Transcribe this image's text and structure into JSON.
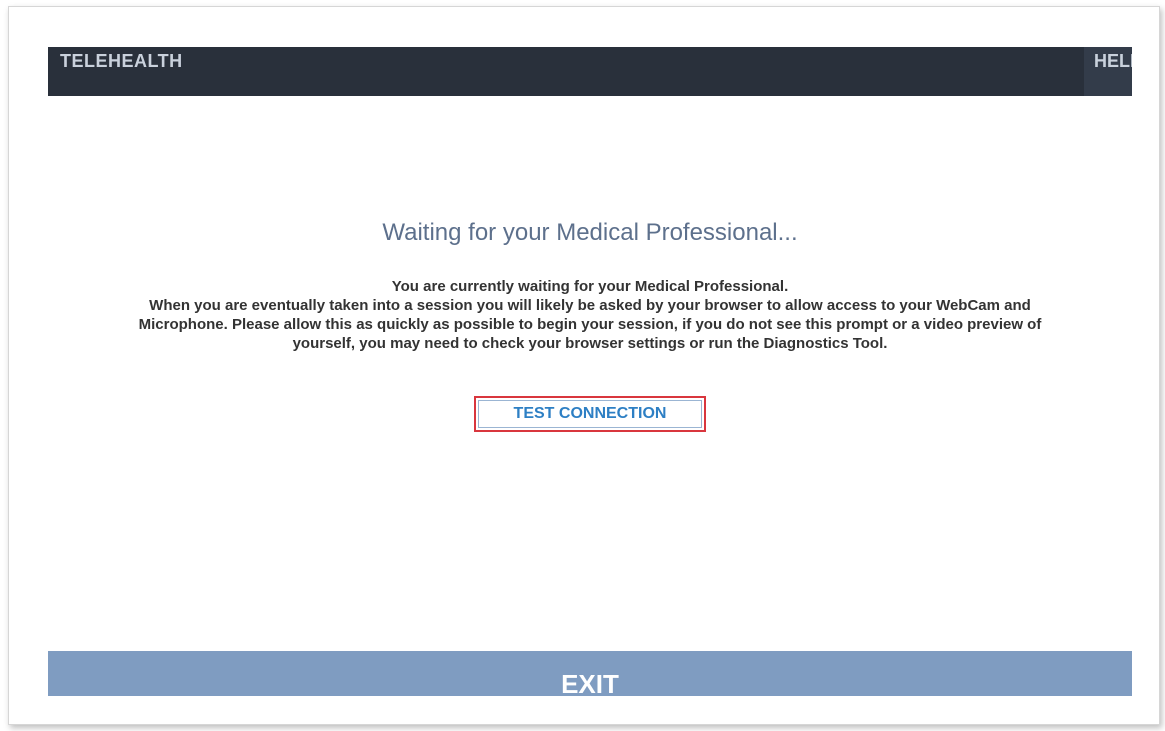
{
  "header": {
    "brand": "TELEHEALTH",
    "help_label": "HELP"
  },
  "main": {
    "title": "Waiting for your Medical Professional...",
    "message_lines": [
      "You are currently waiting for your Medical Professional.",
      "When you are eventually taken into a session you will likely be asked by your browser to allow access to your WebCam and",
      "Microphone. Please allow this as quickly as possible to begin your session, if you do not see this prompt or a video preview of",
      "yourself, you may need to check your browser settings or run the Diagnostics Tool."
    ],
    "test_button": "TEST CONNECTION"
  },
  "footer": {
    "exit_label": "EXIT"
  },
  "colors": {
    "header_bg": "#29303b",
    "title": "#5d708c",
    "button_text": "#2d7fc4",
    "highlight_border": "#d9363e",
    "exit_bg": "#7f9cc1"
  }
}
